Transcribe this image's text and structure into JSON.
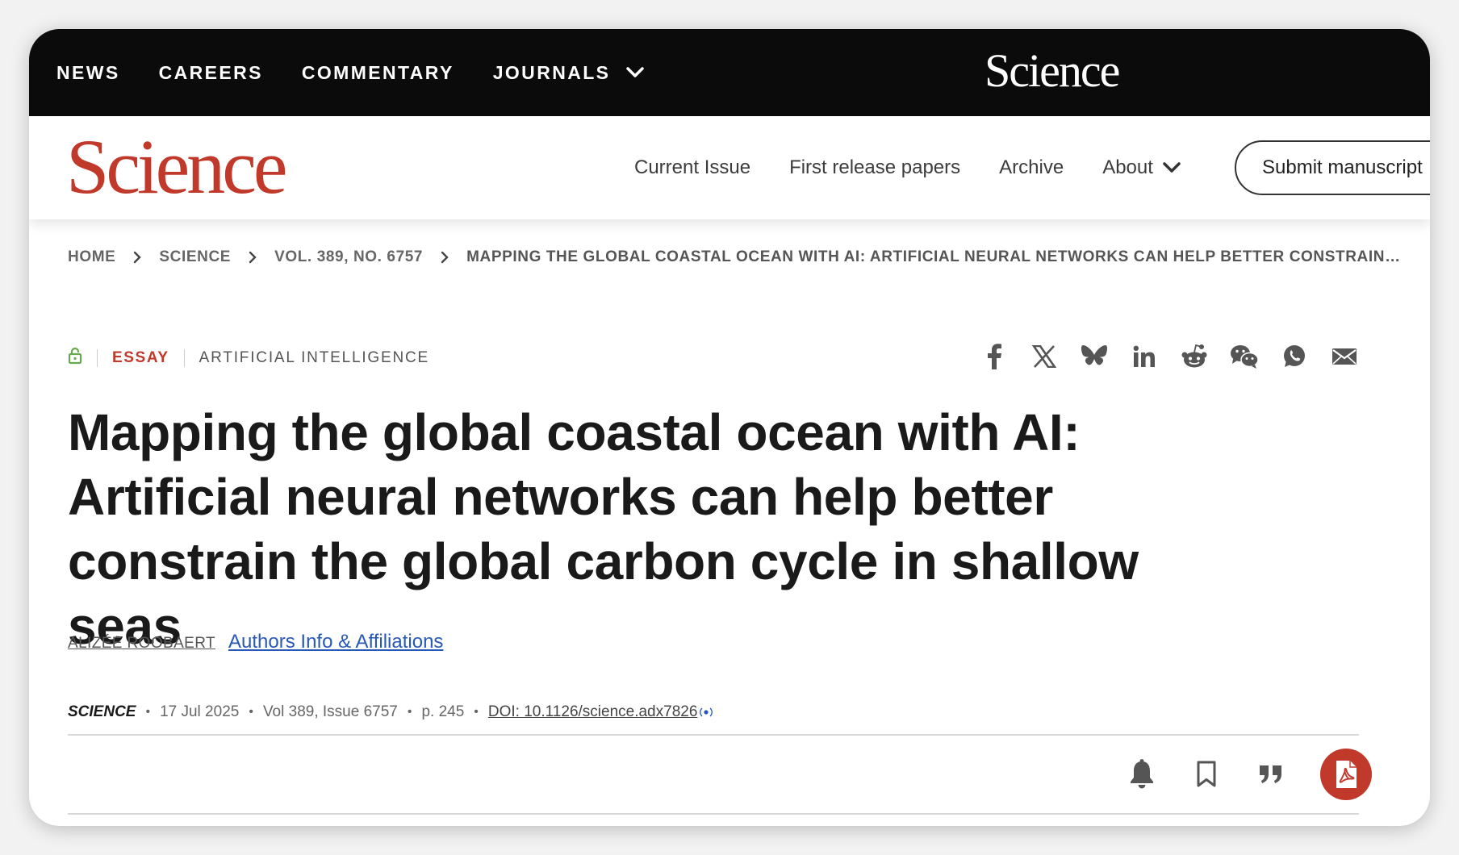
{
  "topbar": {
    "nav": [
      {
        "label": "NEWS"
      },
      {
        "label": "CAREERS"
      },
      {
        "label": "COMMENTARY"
      },
      {
        "label": "JOURNALS"
      }
    ],
    "logo": "Science"
  },
  "header": {
    "brand": "Science",
    "nav": [
      {
        "label": "Current Issue"
      },
      {
        "label": "First release papers"
      },
      {
        "label": "Archive"
      },
      {
        "label": "About"
      }
    ],
    "submit_label": "Submit manuscript"
  },
  "breadcrumb": {
    "items": [
      "HOME",
      "SCIENCE",
      "VOL. 389, NO. 6757"
    ],
    "current": "MAPPING THE GLOBAL COASTAL OCEAN WITH AI: ARTIFICIAL NEURAL NETWORKS CAN HELP BETTER CONSTRAIN…"
  },
  "article": {
    "type": "ESSAY",
    "topic": "ARTIFICIAL INTELLIGENCE",
    "title": "Mapping the global coastal ocean with AI: Artificial neural networks can help better constrain the global carbon cycle in shallow seas",
    "author": "ALIZÉE ROOBAERT",
    "affiliations_link": "Authors Info & Affiliations",
    "citation": {
      "journal": "SCIENCE",
      "date": "17 Jul 2025",
      "volume": "Vol 389, Issue 6757",
      "page": "p. 245",
      "doi": "DOI: 10.1126/science.adx7826"
    }
  },
  "share_icons": [
    "facebook-icon",
    "x-icon",
    "bluesky-icon",
    "linkedin-icon",
    "reddit-icon",
    "wechat-icon",
    "whatsapp-icon",
    "email-icon"
  ],
  "tool_icons": [
    "bell-icon",
    "bookmark-icon",
    "quote-icon",
    "pdf-icon"
  ],
  "colors": {
    "brand_red": "#c0392b",
    "topbar_bg": "#0b0b0b",
    "link_blue": "#2858b8",
    "lock_green": "#6aa84f"
  }
}
